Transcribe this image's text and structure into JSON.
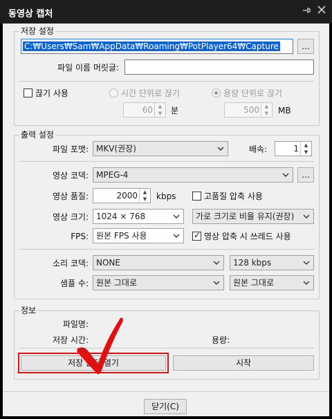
{
  "window": {
    "title": "동영상 캡처",
    "pin_icon": "pin-icon",
    "close_icon": "close-icon"
  },
  "save": {
    "legend": "저장 설정",
    "path": "C:₩Users₩Sam₩AppData₩Roaming₩PotPlayer64₩Capture",
    "browse_label": "...",
    "prefix_label": "파일 이름 머릿글:",
    "prefix_value": "",
    "split_label": "끊기 사용",
    "split_checked": false,
    "time_label": "시간 단위로 끊기",
    "time_value": "60",
    "time_unit": "분",
    "size_label": "용량 단위로 끊기",
    "size_value": "500",
    "size_unit": "MB"
  },
  "output": {
    "legend": "출력 설정",
    "format_label": "파일 포맷:",
    "format_value": "MKV(권장)",
    "speed_label": "배속:",
    "speed_value": "1",
    "vcodec_label": "영상 코덱:",
    "vcodec_value": "MPEG-4",
    "vcodec_btn": "...",
    "quality_label": "영상 품질:",
    "quality_value": "2000",
    "quality_unit": "kbps",
    "hq_label": "고품질 압축 사용",
    "hq_checked": false,
    "size_label": "영상 크기:",
    "size_value": "1024 × 768",
    "aspect_value": "가로 크기로 비율 유지(권장)",
    "fps_label": "FPS:",
    "fps_value": "원본 FPS 사용",
    "thread_label": "영상 압축 시 쓰레드 사용",
    "thread_checked": true,
    "acodec_label": "소리 코덱:",
    "acodec_value": "NONE",
    "abitrate_value": "128 kbps",
    "samplerate_label": "샘플 수:",
    "samplerate_value": "원본 그대로",
    "channels_value": "원본 그대로"
  },
  "info": {
    "legend": "정보",
    "filename_label": "파일명:",
    "time_label": "저장 시간:",
    "size_label": "용량:"
  },
  "buttons": {
    "open_folder": "저장 폴더 열기",
    "start": "시작",
    "close": "닫기(C)"
  },
  "annotation": {
    "checkmark_icon": "red-checkmark-icon",
    "color": "#e01010"
  }
}
